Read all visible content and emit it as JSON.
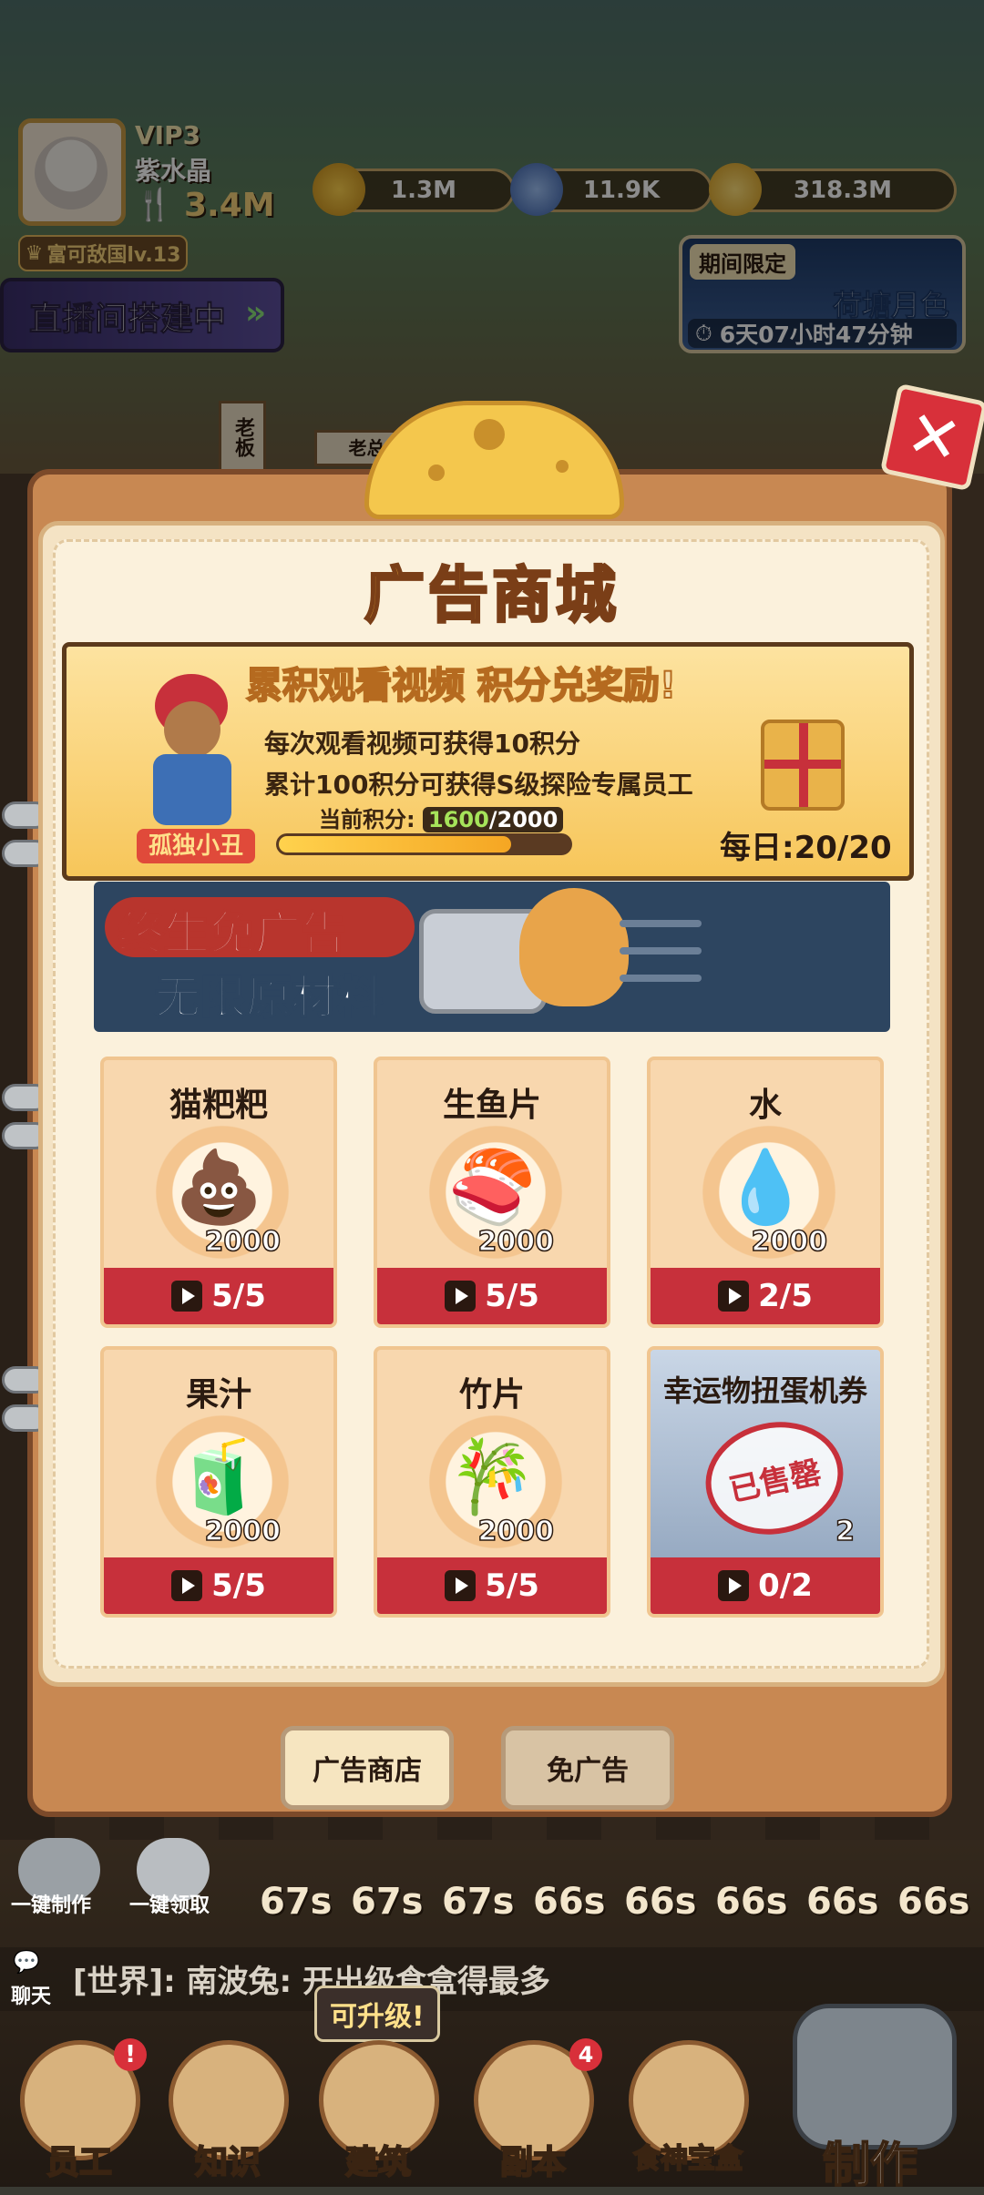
{
  "player": {
    "vip": "VIP3",
    "name": "紫水晶",
    "power": "3.4M",
    "rank": "富可敌国lv.13"
  },
  "currencies": [
    {
      "icon": "trophy-icon",
      "value": "1.3M"
    },
    {
      "icon": "diamond-icon",
      "value": "11.9K"
    },
    {
      "icon": "coin-icon",
      "value": "318.3M"
    }
  ],
  "live_banner": "直播间搭建中",
  "event": {
    "tag": "期间限定",
    "name": "荷塘月色",
    "countdown": "6天07小时47分钟"
  },
  "board_signs": [
    "老板",
    "老总的大订"
  ],
  "shop": {
    "title": "广告商城",
    "points_banner": {
      "heading": "累积观看视频  积分兑奖励!",
      "line1": "每次观看视频可获得10积分",
      "line2": "累计100积分可获得S级探险专属员工",
      "current_label": "当前积分:",
      "current_value": "1600",
      "current_total": "/2000",
      "progress": 0.8,
      "mascot_label": "孤独小丑",
      "daily": "每日:20/20"
    },
    "noads_ad": {
      "line1": "终生免广告",
      "line2": "无限原材料"
    },
    "items": [
      {
        "name": "猫粑粑",
        "icon": "💩",
        "qty": "2000",
        "watch": "5/5",
        "sold_out": false
      },
      {
        "name": "生鱼片",
        "icon": "🍣",
        "qty": "2000",
        "watch": "5/5",
        "sold_out": false
      },
      {
        "name": "水",
        "icon": "💧",
        "qty": "2000",
        "watch": "2/5",
        "sold_out": false
      },
      {
        "name": "果汁",
        "icon": "🧃",
        "qty": "2000",
        "watch": "5/5",
        "sold_out": false
      },
      {
        "name": "竹片",
        "icon": "🎋",
        "qty": "2000",
        "watch": "5/5",
        "sold_out": false
      },
      {
        "name": "幸运物扭蛋机券",
        "icon": "",
        "qty": "2",
        "watch": "0/2",
        "sold_out": true,
        "stamp": "已售罄"
      }
    ],
    "tabs": [
      "广告商店",
      "免广告"
    ]
  },
  "bottom": {
    "auto_make": "一键制作",
    "auto_collect": "一键领取",
    "timers": [
      "67s",
      "67s",
      "67s",
      "66s",
      "66s",
      "66s",
      "66s",
      "66s"
    ],
    "chat_label": "聊天",
    "chat_text": "[世界]: 南波兔: 开出级食盒得最多",
    "upgrade_tip": "可升级!",
    "nav": [
      {
        "label": "员工",
        "badge": "!"
      },
      {
        "label": "知识",
        "badge": ""
      },
      {
        "label": "建筑",
        "badge": ""
      },
      {
        "label": "副本",
        "badge": "4"
      },
      {
        "label": "食神宝盒",
        "badge": ""
      },
      {
        "label": "制作",
        "badge": ""
      }
    ]
  }
}
